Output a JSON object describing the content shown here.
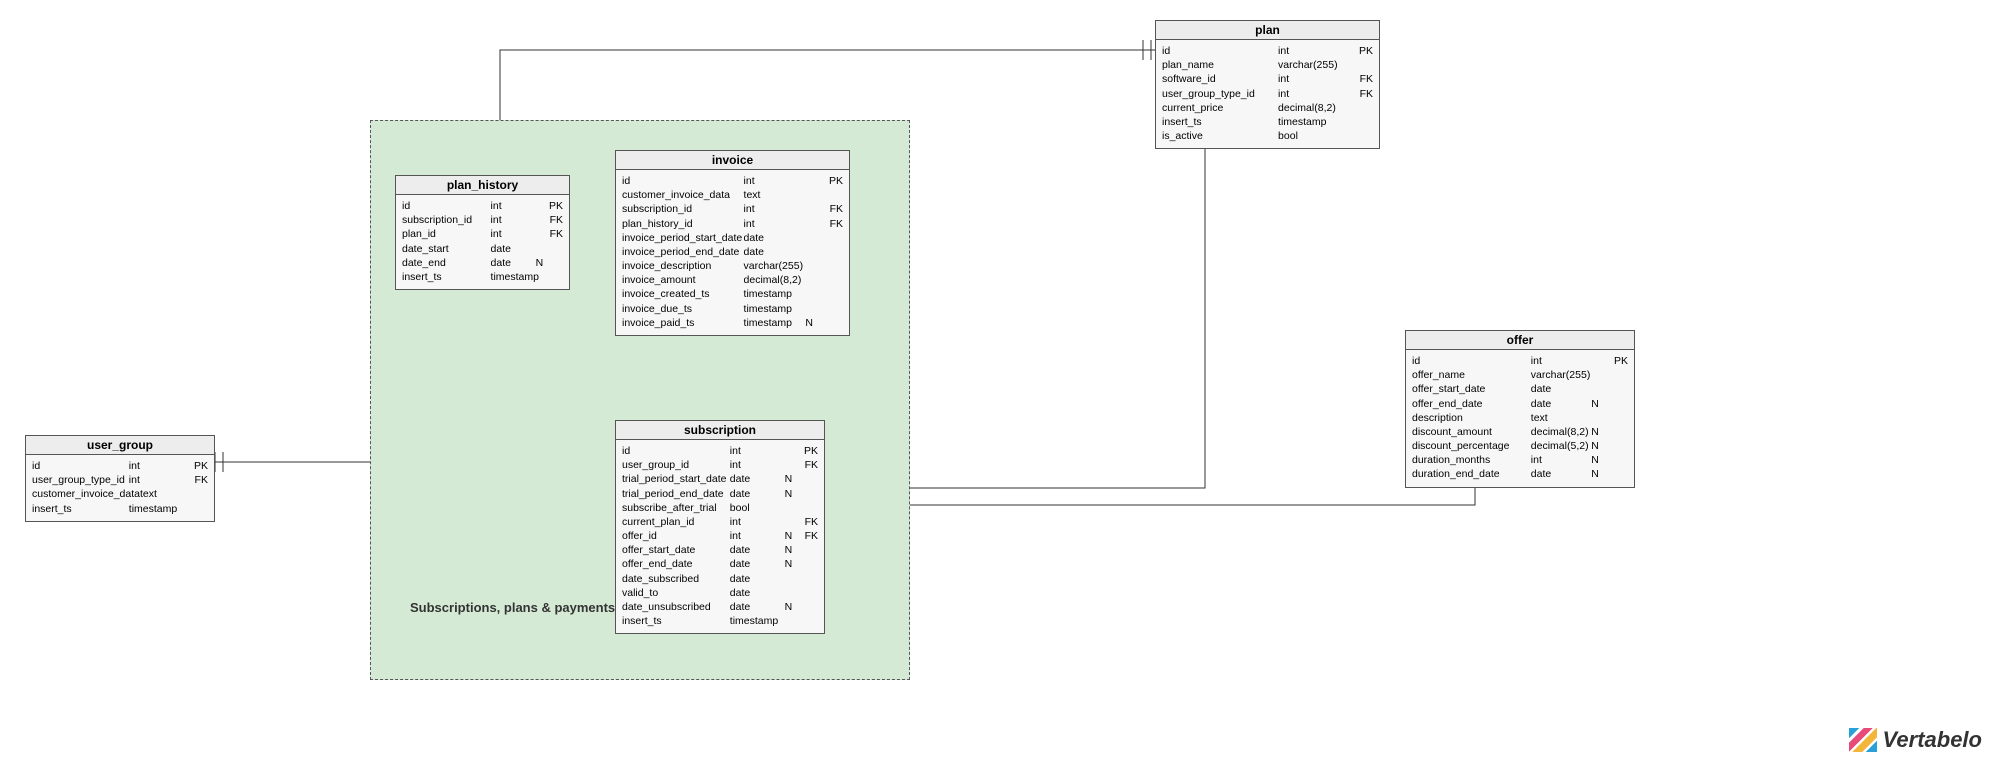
{
  "region": {
    "label": "Subscriptions, plans & payments"
  },
  "logo": "Vertabelo",
  "entities": {
    "plan": {
      "title": "plan",
      "rows": [
        {
          "name": "id",
          "type": "int",
          "n": "",
          "key": "PK"
        },
        {
          "name": "plan_name",
          "type": "varchar(255)",
          "n": "",
          "key": ""
        },
        {
          "name": "software_id",
          "type": "int",
          "n": "",
          "key": "FK"
        },
        {
          "name": "user_group_type_id",
          "type": "int",
          "n": "",
          "key": "FK"
        },
        {
          "name": "current_price",
          "type": "decimal(8,2)",
          "n": "",
          "key": ""
        },
        {
          "name": "insert_ts",
          "type": "timestamp",
          "n": "",
          "key": ""
        },
        {
          "name": "is_active",
          "type": "bool",
          "n": "",
          "key": ""
        }
      ]
    },
    "plan_history": {
      "title": "plan_history",
      "rows": [
        {
          "name": "id",
          "type": "int",
          "n": "",
          "key": "PK"
        },
        {
          "name": "subscription_id",
          "type": "int",
          "n": "",
          "key": "FK"
        },
        {
          "name": "plan_id",
          "type": "int",
          "n": "",
          "key": "FK"
        },
        {
          "name": "date_start",
          "type": "date",
          "n": "",
          "key": ""
        },
        {
          "name": "date_end",
          "type": "date",
          "n": "N",
          "key": ""
        },
        {
          "name": "insert_ts",
          "type": "timestamp",
          "n": "",
          "key": ""
        }
      ]
    },
    "invoice": {
      "title": "invoice",
      "rows": [
        {
          "name": "id",
          "type": "int",
          "n": "",
          "key": "PK"
        },
        {
          "name": "customer_invoice_data",
          "type": "text",
          "n": "",
          "key": ""
        },
        {
          "name": "subscription_id",
          "type": "int",
          "n": "",
          "key": "FK"
        },
        {
          "name": "plan_history_id",
          "type": "int",
          "n": "",
          "key": "FK"
        },
        {
          "name": "invoice_period_start_date",
          "type": "date",
          "n": "",
          "key": ""
        },
        {
          "name": "invoice_period_end_date",
          "type": "date",
          "n": "",
          "key": ""
        },
        {
          "name": "invoice_description",
          "type": "varchar(255)",
          "n": "",
          "key": ""
        },
        {
          "name": "invoice_amount",
          "type": "decimal(8,2)",
          "n": "",
          "key": ""
        },
        {
          "name": "invoice_created_ts",
          "type": "timestamp",
          "n": "",
          "key": ""
        },
        {
          "name": "invoice_due_ts",
          "type": "timestamp",
          "n": "",
          "key": ""
        },
        {
          "name": "invoice_paid_ts",
          "type": "timestamp",
          "n": "N",
          "key": ""
        }
      ]
    },
    "subscription": {
      "title": "subscription",
      "rows": [
        {
          "name": "id",
          "type": "int",
          "n": "",
          "key": "PK"
        },
        {
          "name": "user_group_id",
          "type": "int",
          "n": "",
          "key": "FK"
        },
        {
          "name": "trial_period_start_date",
          "type": "date",
          "n": "N",
          "key": ""
        },
        {
          "name": "trial_period_end_date",
          "type": "date",
          "n": "N",
          "key": ""
        },
        {
          "name": "subscribe_after_trial",
          "type": "bool",
          "n": "",
          "key": ""
        },
        {
          "name": "current_plan_id",
          "type": "int",
          "n": "",
          "key": "FK"
        },
        {
          "name": "offer_id",
          "type": "int",
          "n": "N",
          "key": "FK"
        },
        {
          "name": "offer_start_date",
          "type": "date",
          "n": "N",
          "key": ""
        },
        {
          "name": "offer_end_date",
          "type": "date",
          "n": "N",
          "key": ""
        },
        {
          "name": "date_subscribed",
          "type": "date",
          "n": "",
          "key": ""
        },
        {
          "name": "valid_to",
          "type": "date",
          "n": "",
          "key": ""
        },
        {
          "name": "date_unsubscribed",
          "type": "date",
          "n": "N",
          "key": ""
        },
        {
          "name": "insert_ts",
          "type": "timestamp",
          "n": "",
          "key": ""
        }
      ]
    },
    "user_group": {
      "title": "user_group",
      "rows": [
        {
          "name": "id",
          "type": "int",
          "n": "",
          "key": "PK"
        },
        {
          "name": "user_group_type_id",
          "type": "int",
          "n": "",
          "key": "FK"
        },
        {
          "name": "customer_invoice_data",
          "type": "text",
          "n": "",
          "key": ""
        },
        {
          "name": "insert_ts",
          "type": "timestamp",
          "n": "",
          "key": ""
        }
      ]
    },
    "offer": {
      "title": "offer",
      "rows": [
        {
          "name": "id",
          "type": "int",
          "n": "",
          "key": "PK"
        },
        {
          "name": "offer_name",
          "type": "varchar(255)",
          "n": "",
          "key": ""
        },
        {
          "name": "offer_start_date",
          "type": "date",
          "n": "",
          "key": ""
        },
        {
          "name": "offer_end_date",
          "type": "date",
          "n": "N",
          "key": ""
        },
        {
          "name": "description",
          "type": "text",
          "n": "",
          "key": ""
        },
        {
          "name": "discount_amount",
          "type": "decimal(8,2)",
          "n": "N",
          "key": ""
        },
        {
          "name": "discount_percentage",
          "type": "decimal(5,2)",
          "n": "N",
          "key": ""
        },
        {
          "name": "duration_months",
          "type": "int",
          "n": "N",
          "key": ""
        },
        {
          "name": "duration_end_date",
          "type": "date",
          "n": "N",
          "key": ""
        }
      ]
    }
  }
}
